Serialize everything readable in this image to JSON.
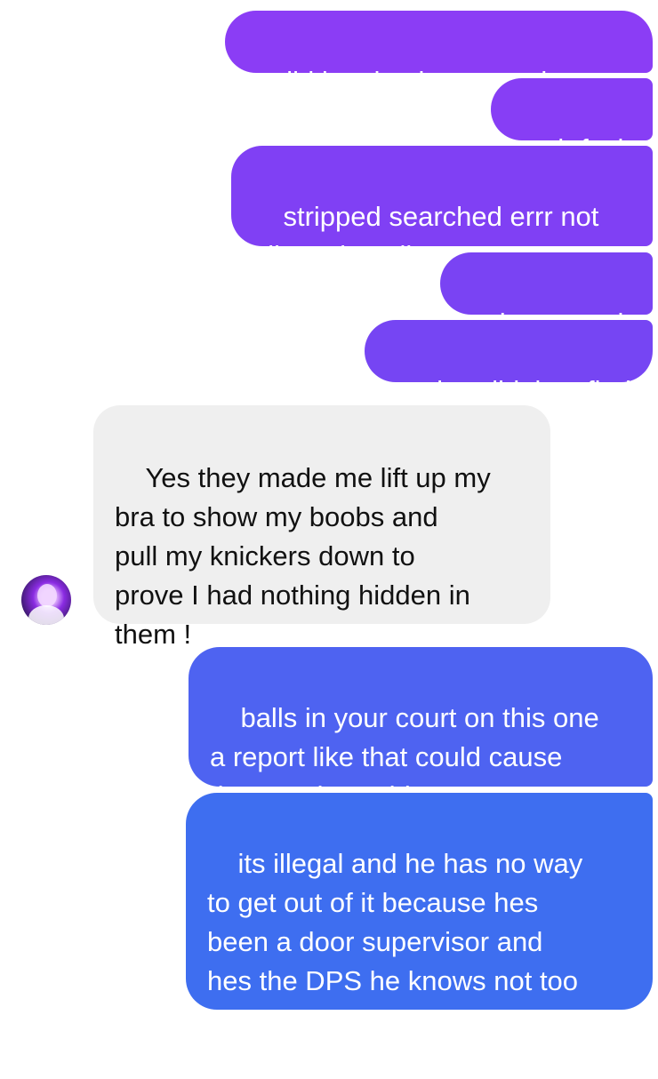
{
  "conversation": {
    "messages": [
      {
        "sender": "me",
        "text": "did he check your underwear"
      },
      {
        "sender": "me",
        "text": "oh fuck"
      },
      {
        "sender": "me",
        "text": "stripped searched errr not\nallowed at all"
      },
      {
        "sender": "me",
        "text": "thats assult"
      },
      {
        "sender": "me",
        "text": "what did they find"
      },
      {
        "sender": "them",
        "text": "Yes they made me lift up my\nbra to show my boobs and\npull my knickers down to\nprove I had nothing hidden in\nthem !"
      },
      {
        "sender": "me",
        "text": "balls in your court on this one\na report like that could cause\nthem serious shit"
      },
      {
        "sender": "me",
        "text": "its illegal and he has no way\nto get out of it because hes\nbeen a door supervisor and\nhes the DPS he knows not too\ndo it"
      }
    ]
  },
  "colors": {
    "outgoing_top": "#8a3ff5",
    "outgoing_mid": "#6b4ef2",
    "outgoing_bottom": "#3f6ef0",
    "incoming": "#efefef"
  }
}
